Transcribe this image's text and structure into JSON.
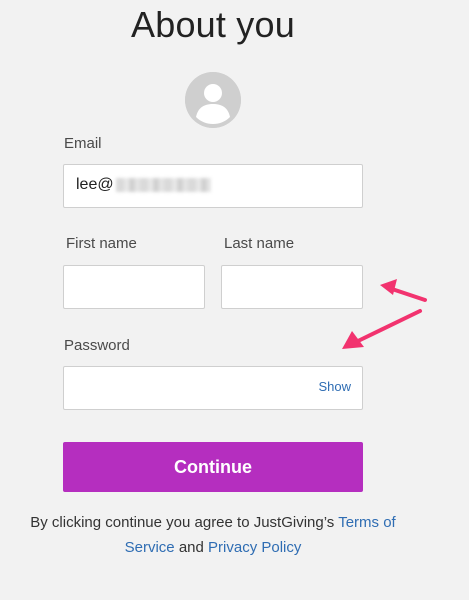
{
  "page": {
    "title": "About you"
  },
  "avatar": {
    "icon": "user-avatar-icon"
  },
  "form": {
    "email": {
      "label": "Email",
      "value": "lee@"
    },
    "first_name": {
      "label": "First name",
      "value": ""
    },
    "last_name": {
      "label": "Last name",
      "value": ""
    },
    "password": {
      "label": "Password",
      "value": "",
      "show_label": "Show"
    },
    "continue_label": "Continue"
  },
  "terms": {
    "prefix": "By clicking continue you agree to JustGiving’s",
    "terms_link": "Terms of Service",
    "conjunction": "and",
    "privacy_link": "Privacy Policy"
  },
  "colors": {
    "accent": "#b52ebf",
    "link": "#2f6db3",
    "annotation_arrow": "#f2336f"
  }
}
